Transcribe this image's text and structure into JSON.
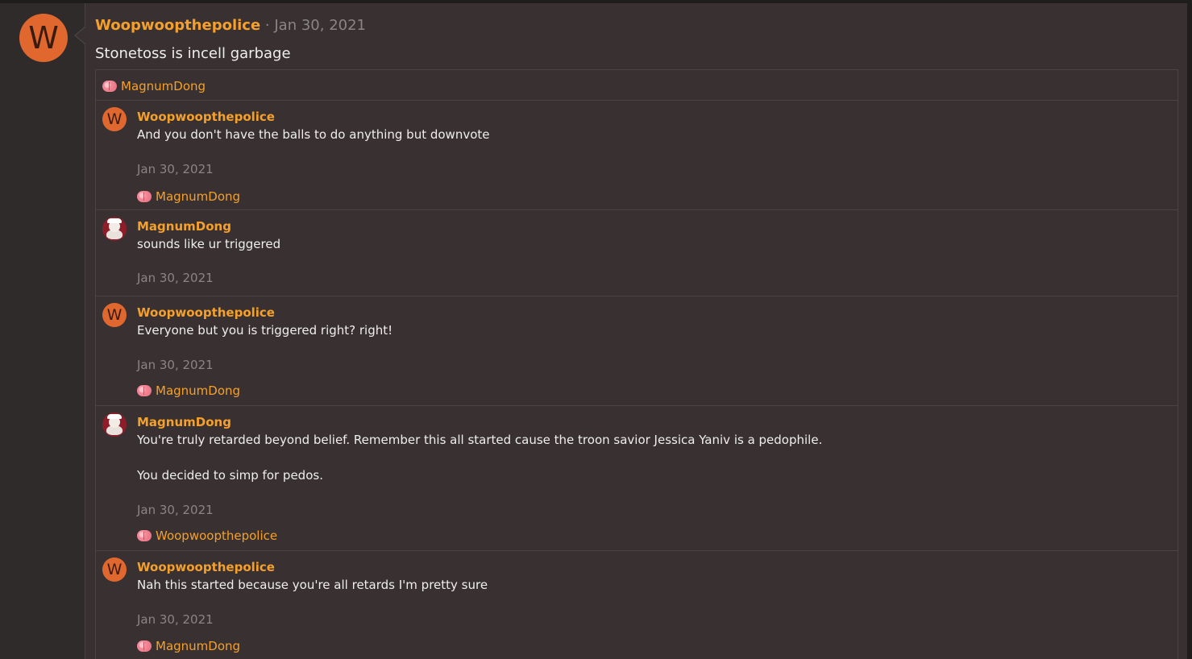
{
  "post": {
    "avatar_letter": "W",
    "author": "Woopwoopthepolice",
    "separator": "·",
    "date": "Jan 30, 2021",
    "body": "Stonetoss is incell garbage"
  },
  "thread": {
    "reaction_user": "MagnumDong",
    "comments": [
      {
        "avatar_letter": "W",
        "author": "Woopwoopthepolice",
        "text": "And you don't have the balls to do anything but downvote",
        "date": "Jan 30, 2021",
        "reaction_user": "MagnumDong"
      },
      {
        "author": "MagnumDong",
        "text": "sounds like ur triggered",
        "date": "Jan 30, 2021"
      },
      {
        "avatar_letter": "W",
        "author": "Woopwoopthepolice",
        "text": "Everyone but you is triggered right? right!",
        "date": "Jan 30, 2021",
        "reaction_user": "MagnumDong"
      },
      {
        "author": "MagnumDong",
        "text": "You're truly retarded beyond belief. Remember this all started cause the troon savior Jessica Yaniv is a pedophile.",
        "text2": "You decided to simp for pedos.",
        "date": "Jan 30, 2021",
        "reaction_user": "Woopwoopthepolice"
      },
      {
        "avatar_letter": "W",
        "author": "Woopwoopthepolice",
        "text": "Nah this started because you're all retards I'm pretty sure",
        "date": "Jan 30, 2021",
        "reaction_user": "MagnumDong"
      }
    ]
  },
  "icons": {
    "reaction": "brain-icon",
    "avatar_picture": "santa-avatar"
  },
  "colors": {
    "accent": "#f5a02a",
    "avatar": "#e0682f",
    "date": "#8a8585",
    "text": "#eeeeee"
  }
}
